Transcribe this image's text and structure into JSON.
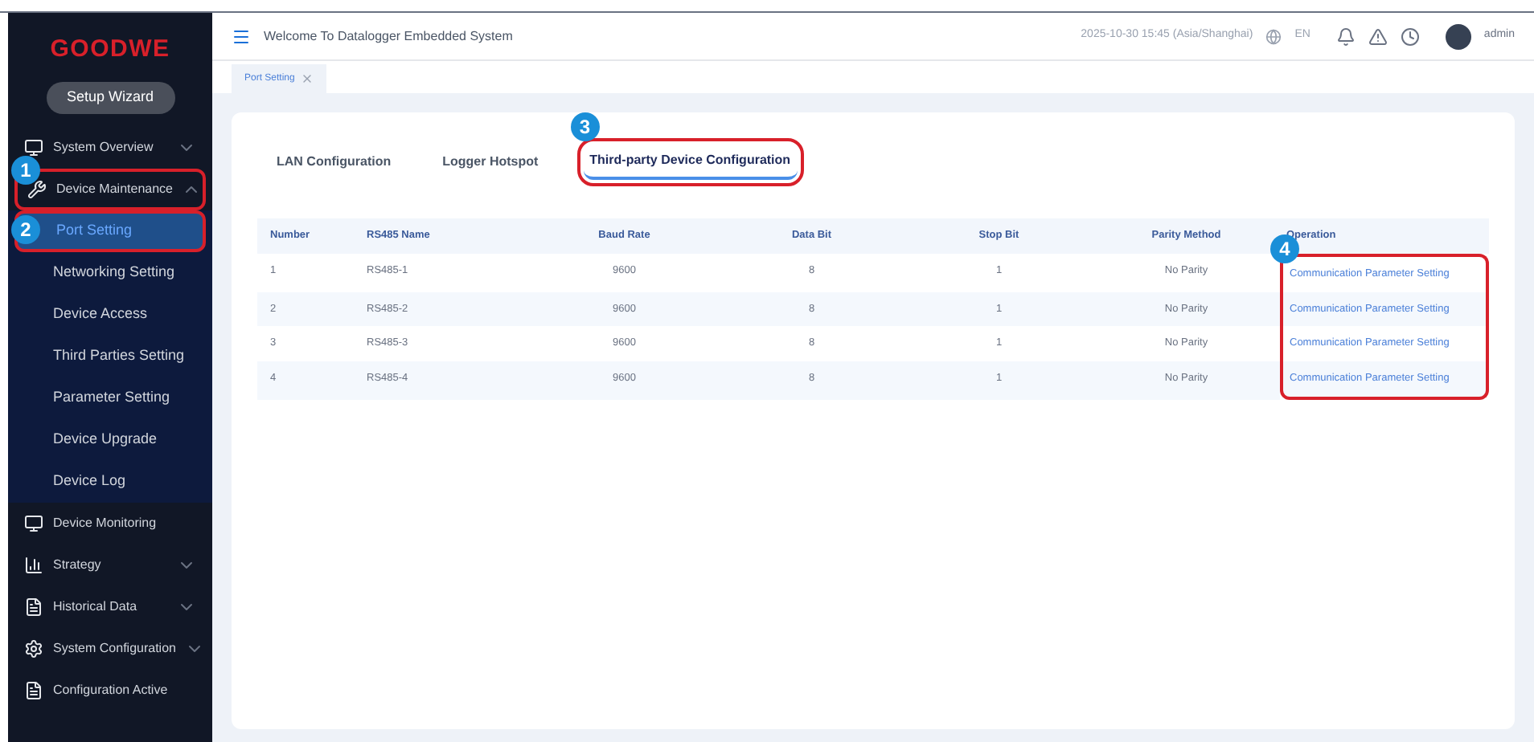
{
  "sidebar": {
    "logo": "GOODWE",
    "setup_button": "Setup Wizard",
    "items": [
      {
        "kind": "group",
        "label": "System Overview",
        "expanded": false,
        "selected": false
      },
      {
        "kind": "group",
        "label": "Device Maintenance",
        "expanded": true,
        "selected": false,
        "callout": "1",
        "children": [
          {
            "label": "Port Setting",
            "selected": true,
            "callout": "2"
          },
          {
            "label": "Networking Setting",
            "selected": false
          },
          {
            "label": "Device Access",
            "selected": false
          },
          {
            "label": "Third Parties Setting",
            "selected": false
          },
          {
            "label": "Parameter Setting",
            "selected": false
          },
          {
            "label": "Device Upgrade",
            "selected": false
          },
          {
            "label": "Device Log",
            "selected": false
          }
        ]
      },
      {
        "kind": "link",
        "label": "Device Monitoring",
        "selected": false
      },
      {
        "kind": "group",
        "label": "Strategy",
        "expanded": false,
        "selected": false
      },
      {
        "kind": "group",
        "label": "Historical Data",
        "expanded": false,
        "selected": false
      },
      {
        "kind": "group",
        "label": "System Configuration",
        "expanded": false,
        "selected": false
      },
      {
        "kind": "link",
        "label": "Configuration Active",
        "selected": false
      }
    ]
  },
  "header": {
    "title": "Welcome To Datalogger Embedded System",
    "datetime": "2025-10-30 15:45 (Asia/Shanghai)",
    "language": "EN",
    "user": "admin"
  },
  "page_tabs": [
    {
      "label": "Port Setting",
      "selected": true
    }
  ],
  "tabs": [
    {
      "label": "LAN Configuration",
      "selected": false
    },
    {
      "label": "Logger Hotspot",
      "selected": false
    },
    {
      "label": "Third-party Device Configuration",
      "selected": true,
      "callout": "3"
    }
  ],
  "table": {
    "columns": [
      "Number",
      "RS485 Name",
      "Baud Rate",
      "Data Bit",
      "Stop Bit",
      "Parity Method",
      "Operation"
    ],
    "operation_callout": "4",
    "rows": [
      [
        "1",
        "RS485-1",
        "9600",
        "8",
        "1",
        "No Parity",
        "Communication Parameter Setting"
      ],
      [
        "2",
        "RS485-2",
        "9600",
        "8",
        "1",
        "No Parity",
        "Communication Parameter Setting"
      ],
      [
        "3",
        "RS485-3",
        "9600",
        "8",
        "1",
        "No Parity",
        "Communication Parameter Setting"
      ],
      [
        "4",
        "RS485-4",
        "9600",
        "8",
        "1",
        "No Parity",
        "Communication Parameter Setting"
      ]
    ]
  }
}
